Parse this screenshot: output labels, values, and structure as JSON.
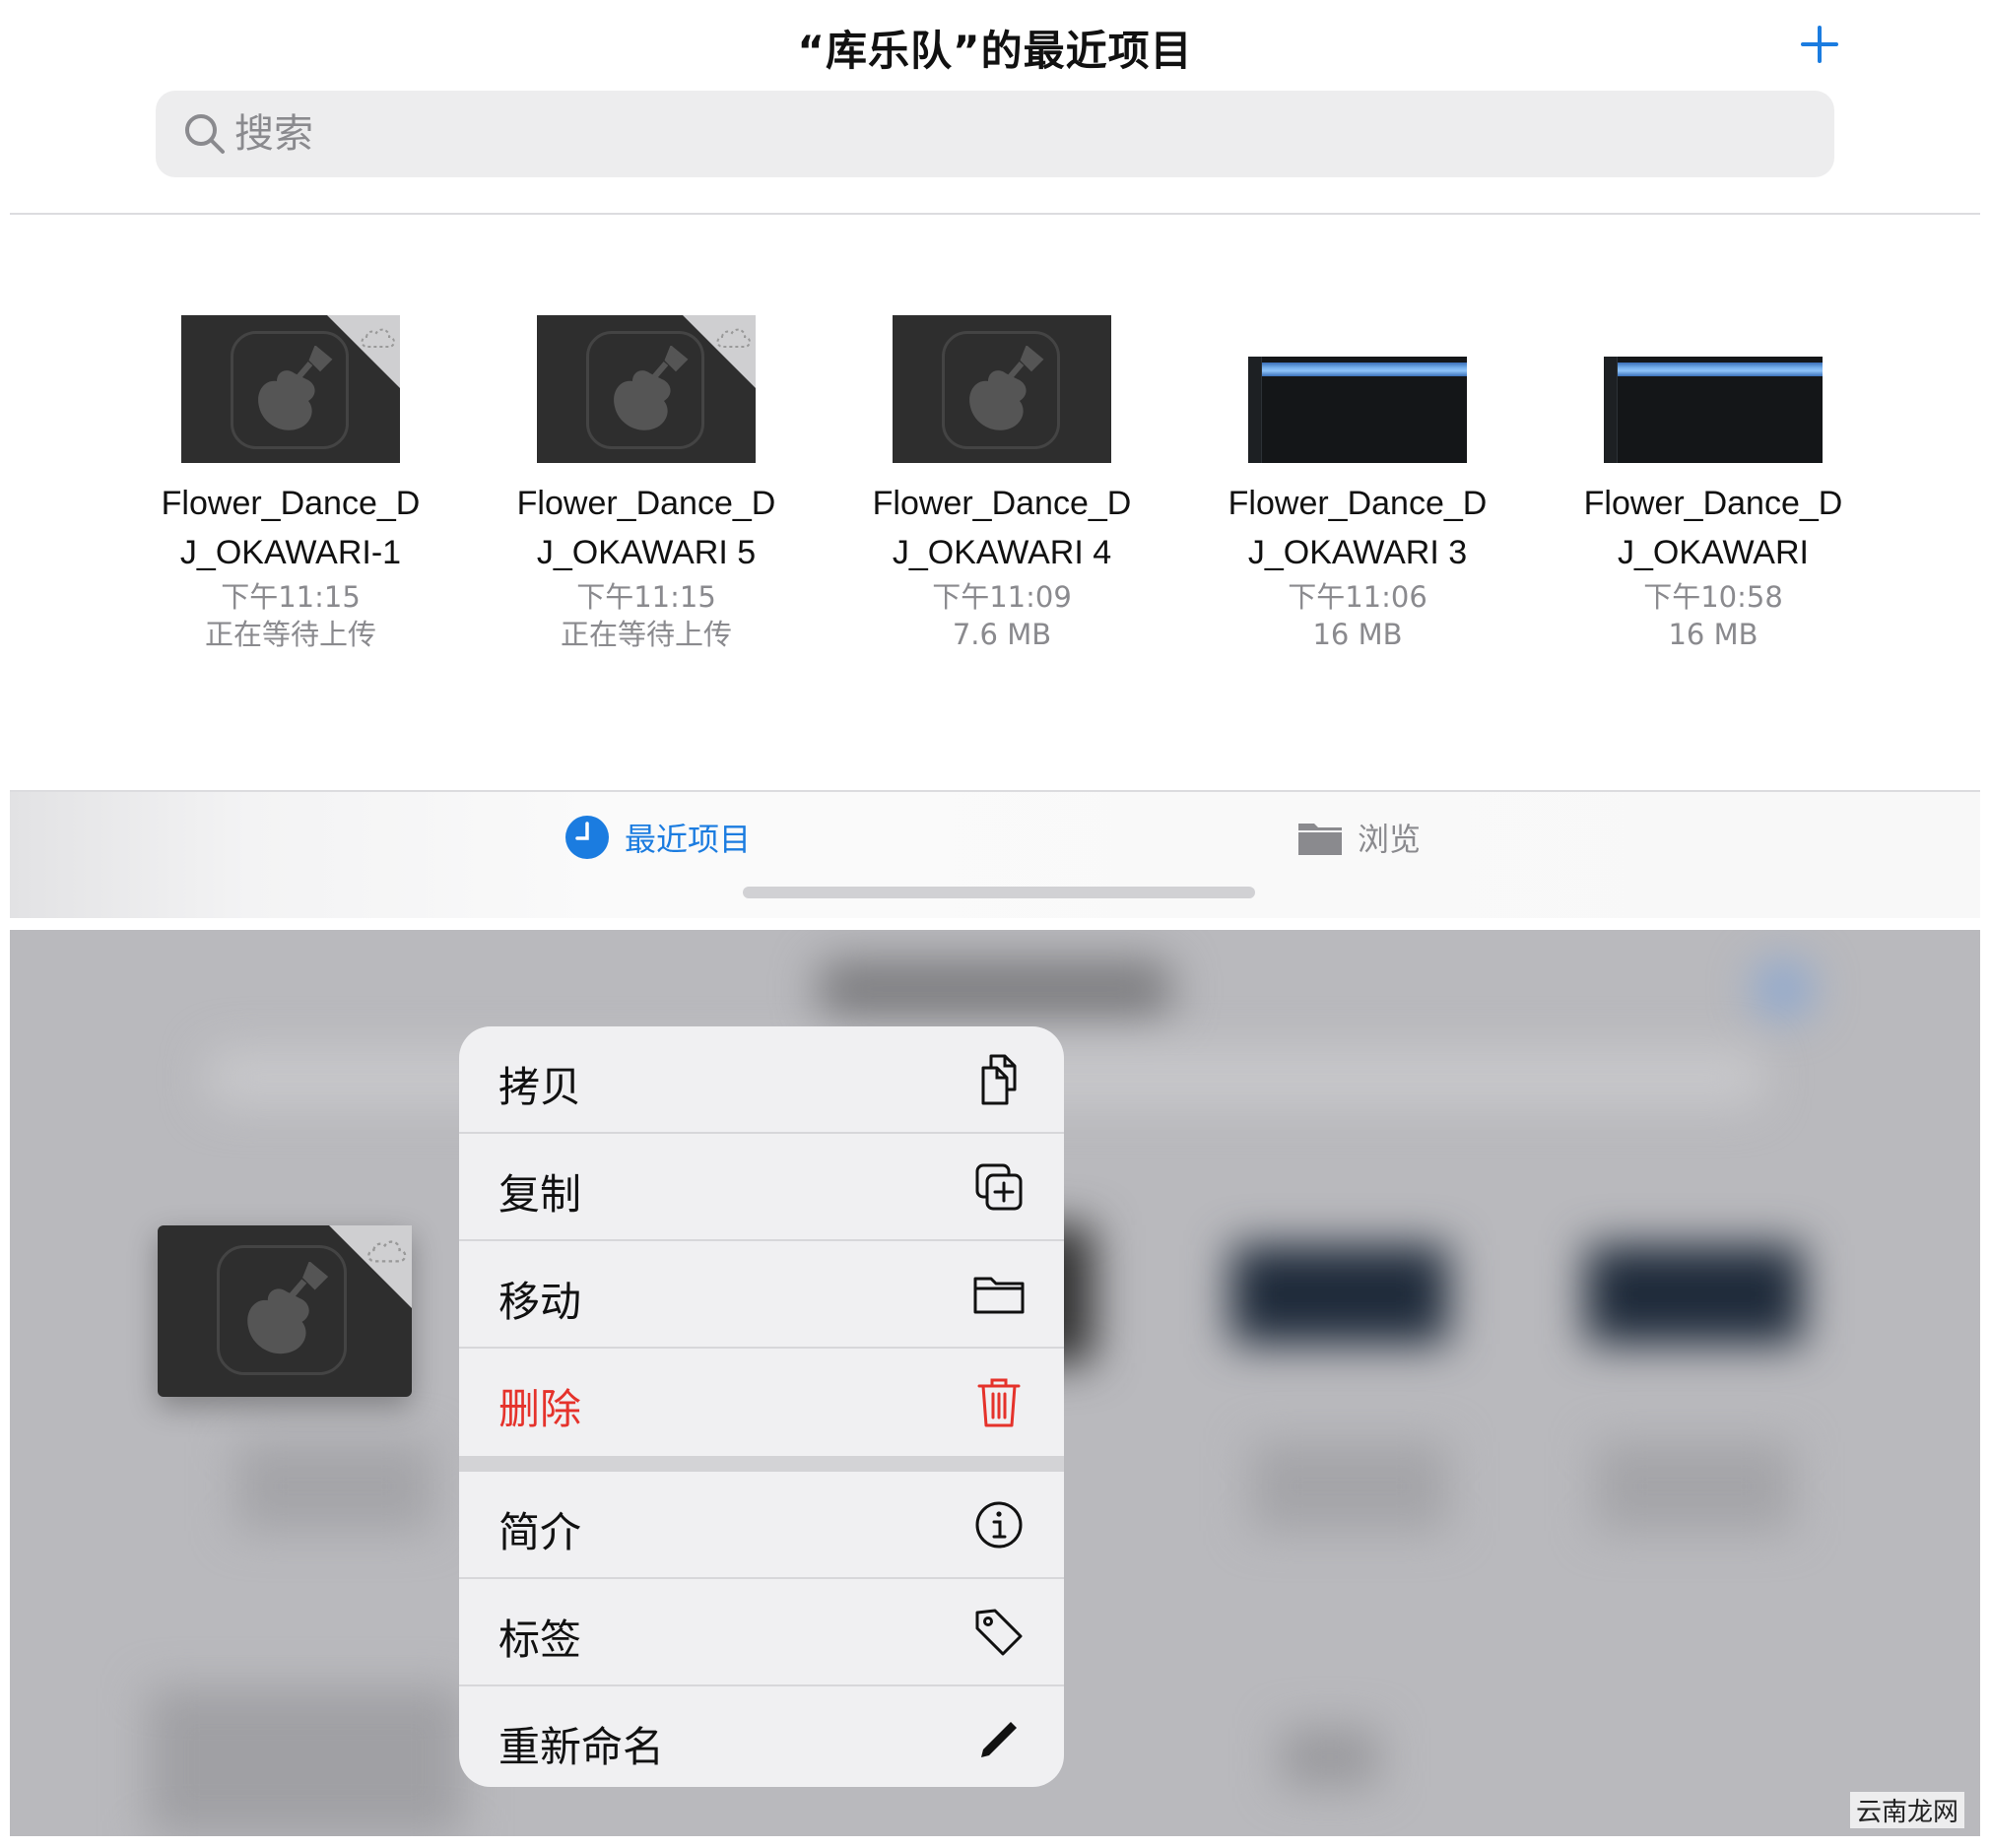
{
  "header": {
    "title": "“库乐队”的最近项目",
    "add_icon": "plus-icon",
    "accent": "#1b7ce0"
  },
  "search": {
    "placeholder": "搜索",
    "icon": "search-icon"
  },
  "files": [
    {
      "name": "Flower_Dance_DJ_OKAWARI-1",
      "name_line1": "Flower_Dance_D",
      "name_line2": "J_OKAWARI-1",
      "time": "下午11:15",
      "status": "正在等待上传",
      "thumb": "garageband",
      "cloud": true
    },
    {
      "name": "Flower_Dance_DJ_OKAWARI 5",
      "name_line1": "Flower_Dance_D",
      "name_line2": "J_OKAWARI 5",
      "time": "下午11:15",
      "status": "正在等待上传",
      "thumb": "garageband",
      "cloud": true
    },
    {
      "name": "Flower_Dance_DJ_OKAWARI 4",
      "name_line1": "Flower_Dance_D",
      "name_line2": "J_OKAWARI 4",
      "time": "下午11:09",
      "status": "7.6 MB",
      "thumb": "garageband",
      "cloud": false
    },
    {
      "name": "Flower_Dance_DJ_OKAWARI 3",
      "name_line1": "Flower_Dance_D",
      "name_line2": "J_OKAWARI 3",
      "time": "下午11:06",
      "status": "16 MB",
      "thumb": "tracks",
      "cloud": false
    },
    {
      "name": "Flower_Dance_DJ_OKAWARI",
      "name_line1": "Flower_Dance_D",
      "name_line2": "J_OKAWARI",
      "time": "下午10:58",
      "status": "16 MB",
      "thumb": "tracks",
      "cloud": false
    }
  ],
  "tabs": [
    {
      "label": "最近项目",
      "icon": "clock-icon",
      "active": true
    },
    {
      "label": "浏览",
      "icon": "folder-icon",
      "active": false
    }
  ],
  "context_menu": {
    "items": [
      {
        "label": "拷贝",
        "icon": "copy-icon"
      },
      {
        "label": "复制",
        "icon": "duplicate-icon"
      },
      {
        "label": "移动",
        "icon": "folder-icon"
      },
      {
        "label": "删除",
        "icon": "trash-icon",
        "destructive": true,
        "color": "#e5322b"
      },
      {
        "label": "简介",
        "icon": "info-icon"
      },
      {
        "label": "标签",
        "icon": "tag-icon"
      },
      {
        "label": "重新命名",
        "icon": "pencil-icon"
      }
    ]
  },
  "watermark": "云南龙网"
}
